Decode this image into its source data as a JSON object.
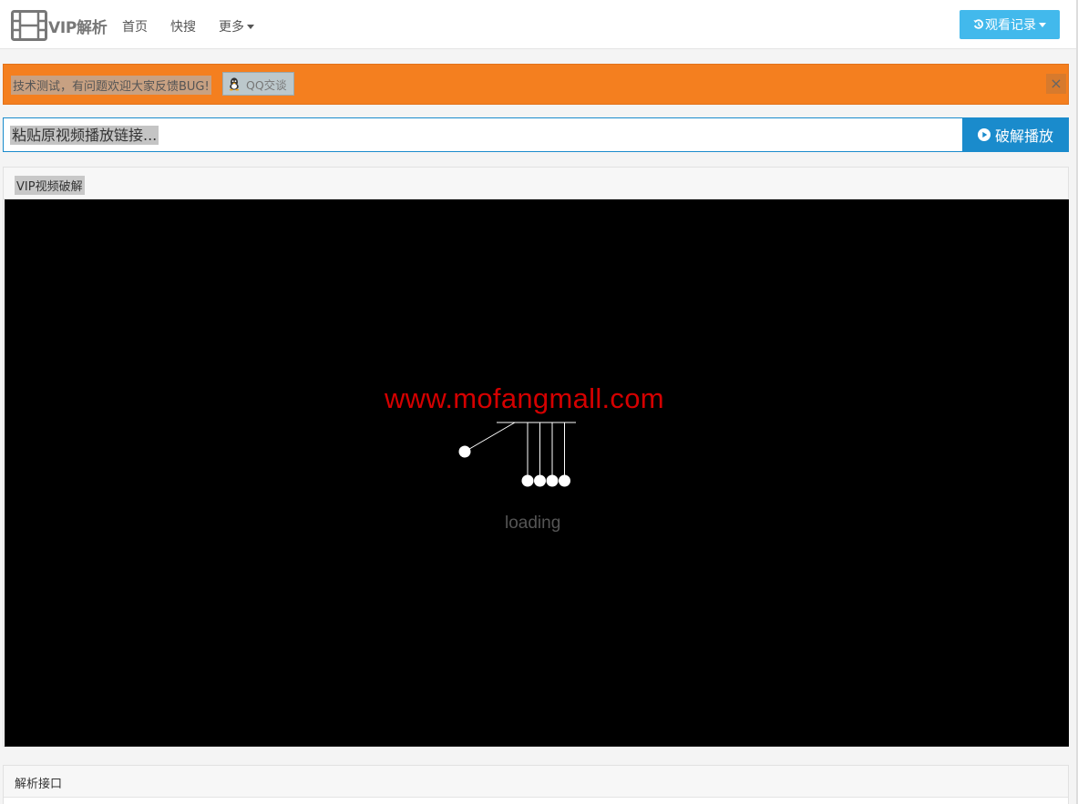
{
  "nav": {
    "brand": "VIP解析",
    "links": [
      "首页",
      "快搜",
      "更多"
    ],
    "history_button": "观看记录"
  },
  "alert": {
    "message": "技术测试，有问题欢迎大家反馈BUG!",
    "qq_button": "QQ交谈",
    "close": "×"
  },
  "search": {
    "placeholder": "粘贴原视频播放链接...",
    "value": "",
    "submit": "破解播放"
  },
  "player_panel": {
    "title": "VIP视频破解",
    "watermark": "www.mofangmall.com",
    "loading": "loading"
  },
  "api_panel": {
    "title": "解析接口"
  },
  "colors": {
    "accent": "#1a8bcc",
    "history_button": "#42b9ec",
    "alert": "#f47f1f",
    "watermark": "#d40000"
  }
}
